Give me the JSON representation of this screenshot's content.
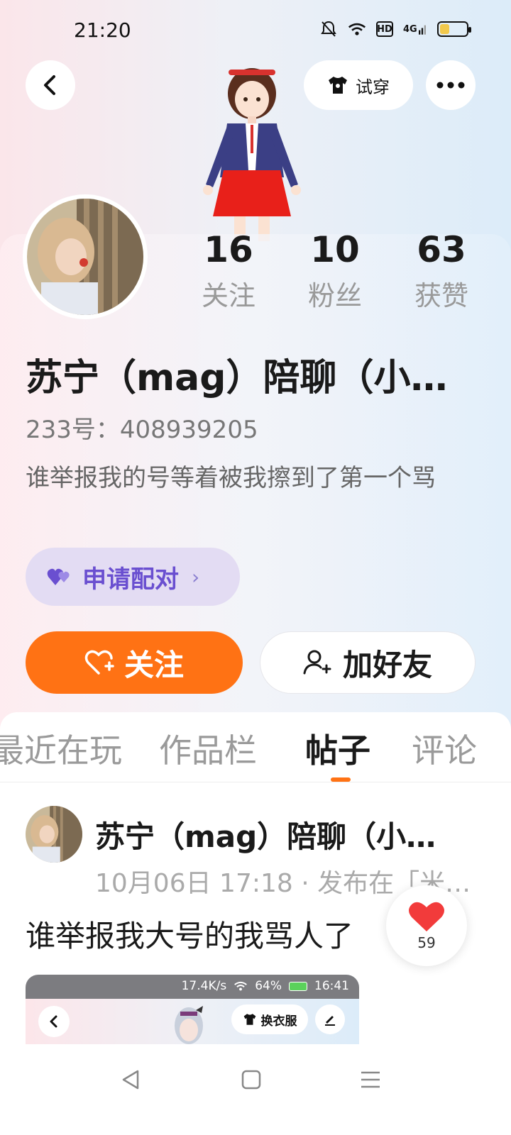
{
  "status_bar": {
    "time": "21:20",
    "icons": [
      "bell-muted-icon",
      "wifi-icon",
      "hd-icon",
      "4g-signal-icon",
      "battery-icon"
    ],
    "hd_label": "HD",
    "network_label": "4G",
    "battery_level": 0.35,
    "battery_color": "#f2c94c"
  },
  "header": {
    "try_on_label": "试穿"
  },
  "stats": [
    {
      "num": "16",
      "label": "关注"
    },
    {
      "num": "10",
      "label": "粉丝"
    },
    {
      "num": "63",
      "label": "获赞"
    }
  ],
  "profile": {
    "name": "苏宁（mag）陪聊（小…",
    "account_id": "233号：408939205",
    "bio": "谁举报我的号等着被我擦到了第一个骂",
    "match_label": "申请配对",
    "follow_label": "关注",
    "add_friend_label": "加好友"
  },
  "tabs": [
    {
      "label": "最近在玩",
      "active": false
    },
    {
      "label": "作品栏",
      "active": false
    },
    {
      "label": "帖子",
      "active": true
    },
    {
      "label": "评论",
      "active": false
    }
  ],
  "post": {
    "author": "苏宁（mag）陪聊（小…",
    "meta": "10月06日 17:18 · 发布在「米…",
    "text": "谁举报我大号的我骂人了",
    "like_count": "59",
    "embedded": {
      "status_text": "17.4K/s",
      "battery_text": "64%",
      "time_text": "16:41",
      "outfit_label": "换衣服"
    }
  },
  "colors": {
    "accent": "#ff7214",
    "match_bg": "#e3dcf3",
    "match_text": "#6a4fd0",
    "like_red": "#f23b3b"
  }
}
